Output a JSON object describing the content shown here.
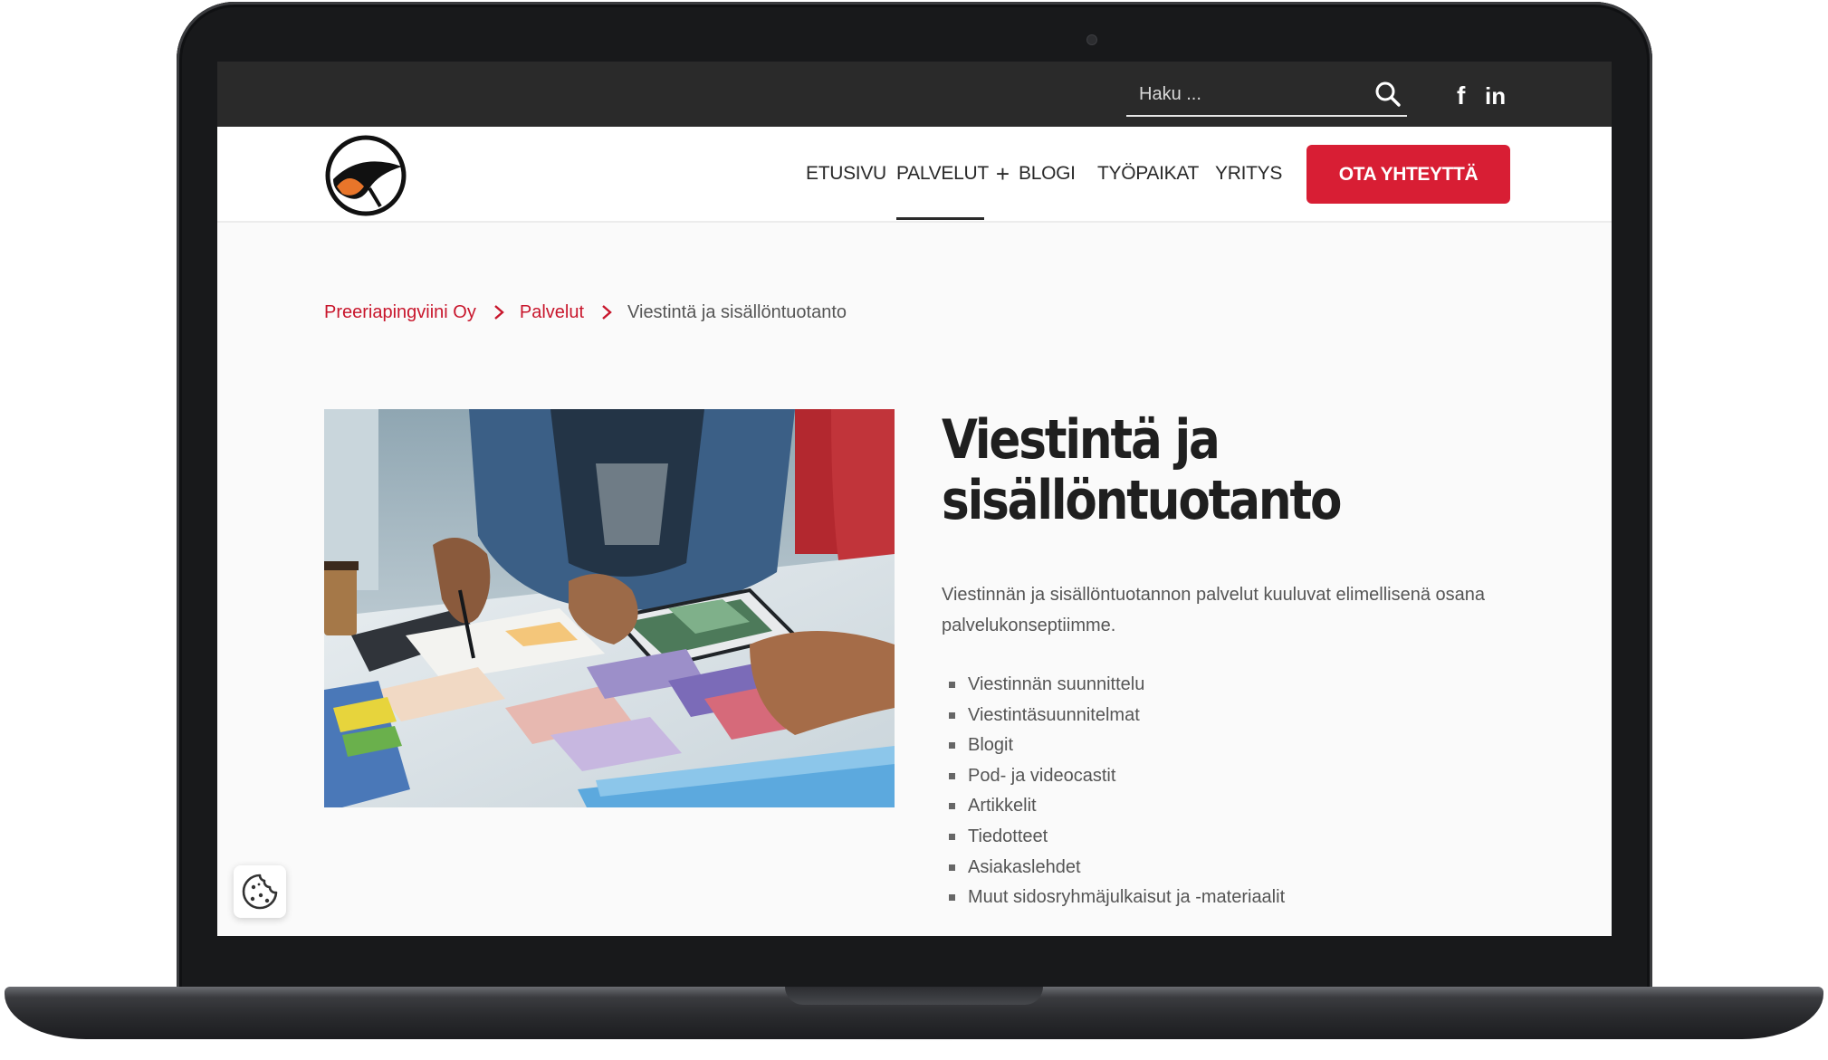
{
  "search": {
    "placeholder": "Haku ..."
  },
  "social": {
    "facebook": "f",
    "linkedin": "in"
  },
  "nav": {
    "items": [
      {
        "label": "ETUSIVU"
      },
      {
        "label": "PALVELUT",
        "suffix": "+"
      },
      {
        "label": "BLOGI"
      },
      {
        "label": "TYÖPAIKAT"
      },
      {
        "label": "YRITYS"
      }
    ],
    "cta_label": "OTA YHTEYTTÄ",
    "active": "PALVELUT"
  },
  "breadcrumb": {
    "items": [
      {
        "label": "Preeriapingviini Oy",
        "link": true
      },
      {
        "label": "Palvelut",
        "link": true
      },
      {
        "label": "Viestintä ja sisällöntuotanto",
        "link": false
      }
    ]
  },
  "main": {
    "title_line1": "Viestintä ja",
    "title_line2": "sisällöntuotanto",
    "intro": "Viestinnän ja sisällöntuotannon palvelut kuuluvat elimellisenä osana palvelukonseptiimme.",
    "services": [
      "Viestinnän suunnittelu",
      "Viestintäsuunnitelmat",
      "Blogit",
      "Pod- ja videocastit",
      "Artikkelit",
      "Tiedotteet",
      "Asiakaslehdet",
      "Muut sidosryhmäjulkaisut ja -materiaalit"
    ]
  },
  "colors": {
    "accent": "#d81e34",
    "topbar": "#2a2a2a",
    "text": "#555555",
    "heading": "#1f1f1f"
  }
}
